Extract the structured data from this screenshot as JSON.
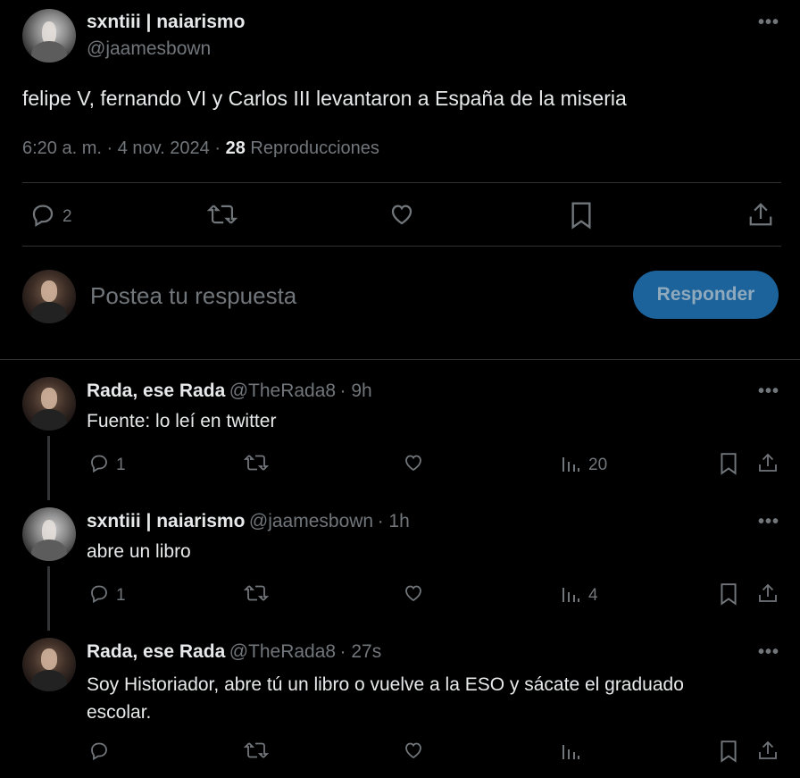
{
  "main_post": {
    "author_name": "sxntiii | naiarismo",
    "author_handle": "@jaamesbown",
    "text": "felipe V, fernando VI y Carlos III levantaron a España de la miseria",
    "time": "6:20 a. m.",
    "sep1": "·",
    "date": "4 nov. 2024",
    "sep2": "·",
    "views_count": "28",
    "views_label": "Reproducciones",
    "reply_count": "2"
  },
  "composer": {
    "placeholder": "Postea tu respuesta",
    "button_label": "Responder"
  },
  "replies": [
    {
      "author_name": "Rada, ese Rada",
      "author_handle": "@TheRada8",
      "time": "· 9h",
      "text": "Fuente: lo leí en twitter",
      "reply_count": "1",
      "views": "20"
    },
    {
      "author_name": "sxntiii | naiarismo",
      "author_handle": "@jaamesbown",
      "time": "· 1h",
      "text": "abre un libro",
      "reply_count": "1",
      "views": "4"
    },
    {
      "author_name": "Rada, ese Rada",
      "author_handle": "@TheRada8",
      "time": "· 27s",
      "text": "Soy Historiador, abre tú un libro o vuelve a la ESO y sácate el graduado escolar.",
      "reply_count": "",
      "views": ""
    }
  ],
  "more_label": "•••",
  "colors": {
    "background": "#000000",
    "text": "#e7e9ea",
    "muted": "#71767b",
    "accent_button": "#1d639b",
    "divider": "#2f3336"
  },
  "icons": [
    "more-icon",
    "reply-icon",
    "retweet-icon",
    "like-icon",
    "bookmark-icon",
    "share-icon",
    "views-icon"
  ]
}
